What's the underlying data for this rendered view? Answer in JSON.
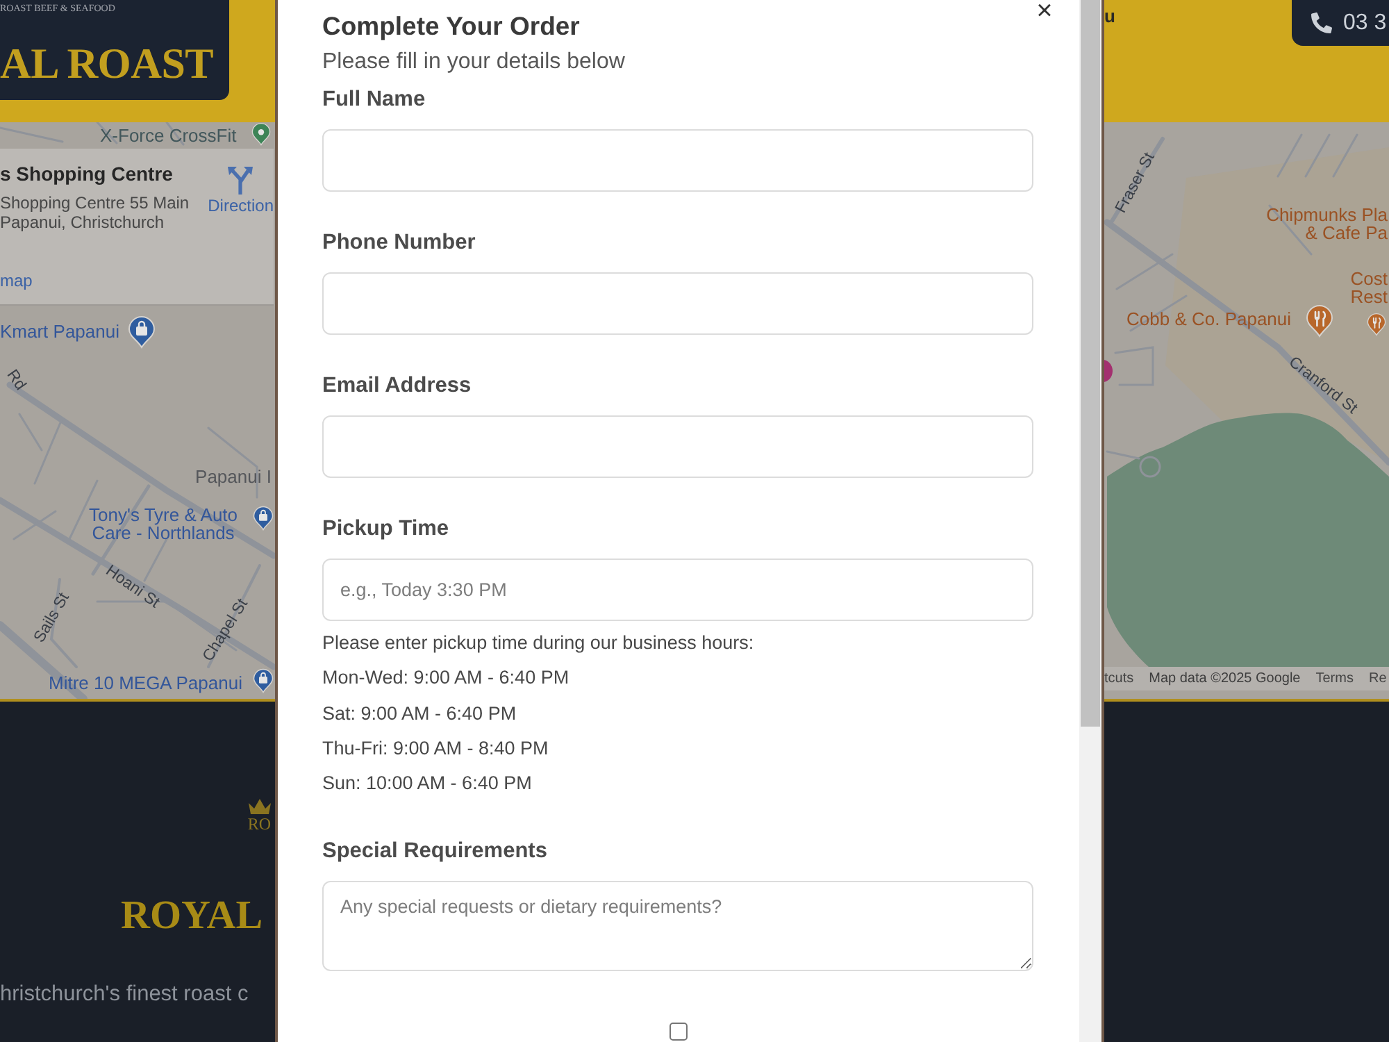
{
  "header": {
    "logo_tagline": "ROAST BEEF & SEAFOOD",
    "logo_name": "AL ROAST",
    "nav_fragment": "u",
    "phone": "03 3"
  },
  "map": {
    "info_card": {
      "title": "s Shopping Centre",
      "address": [
        "Shopping Centre 55 Main",
        "Papanui, Christchurch"
      ],
      "link": "map",
      "directions": "Direction"
    },
    "places": [
      {
        "lines": [
          "X-Force CrossFit"
        ],
        "kind": "fitness"
      },
      {
        "lines": [
          "Kmart Papanui"
        ],
        "kind": "shopping"
      },
      {
        "lines": [
          "Tony's Tyre & Auto",
          "Care - Northlands"
        ],
        "kind": "shopping"
      },
      {
        "lines": [
          "Mitre 10 MEGA Papanui"
        ],
        "kind": "shopping"
      },
      {
        "lines": [
          "Chipmunks Pla",
          "& Cafe Pa"
        ],
        "kind": "food"
      },
      {
        "lines": [
          "Cost",
          "Rest"
        ],
        "kind": "food"
      },
      {
        "lines": [
          "Cobb & Co. Papanui"
        ],
        "kind": "food"
      }
    ],
    "labels": [
      "Rd",
      "Papanui I",
      "Hoani St",
      "Sails St",
      "Chapel St",
      "Fraser St",
      "Cranford St"
    ],
    "attribution": [
      "tcuts",
      "Map data ©2025 Google",
      "Terms",
      "Re"
    ]
  },
  "footer": {
    "logo_text": "RO",
    "brand": "ROYAL",
    "tagline": "hristchurch's finest roast c"
  },
  "modal": {
    "title": "Complete Your Order",
    "subtitle": "Please fill in your details below",
    "close": "×",
    "fields": [
      {
        "label": "Full Name",
        "kind": "input"
      },
      {
        "label": "Phone Number",
        "kind": "input"
      },
      {
        "label": "Email Address",
        "kind": "input"
      },
      {
        "label": "Pickup Time",
        "kind": "input",
        "placeholder": "e.g., Today 3:30 PM",
        "hint": "Please enter pickup time during our business hours:",
        "hours": [
          "Mon-Wed: 9:00 AM - 6:40 PM",
          "Sat: 9:00 AM - 6:40 PM",
          "Thu-Fri: 9:00 AM - 8:40 PM",
          "Sun: 10:00 AM - 6:40 PM"
        ]
      },
      {
        "label": "Special Requirements",
        "kind": "textarea",
        "placeholder": "Any special requests or dietary requirements?"
      }
    ],
    "checkbox": {
      "checked": false
    }
  }
}
